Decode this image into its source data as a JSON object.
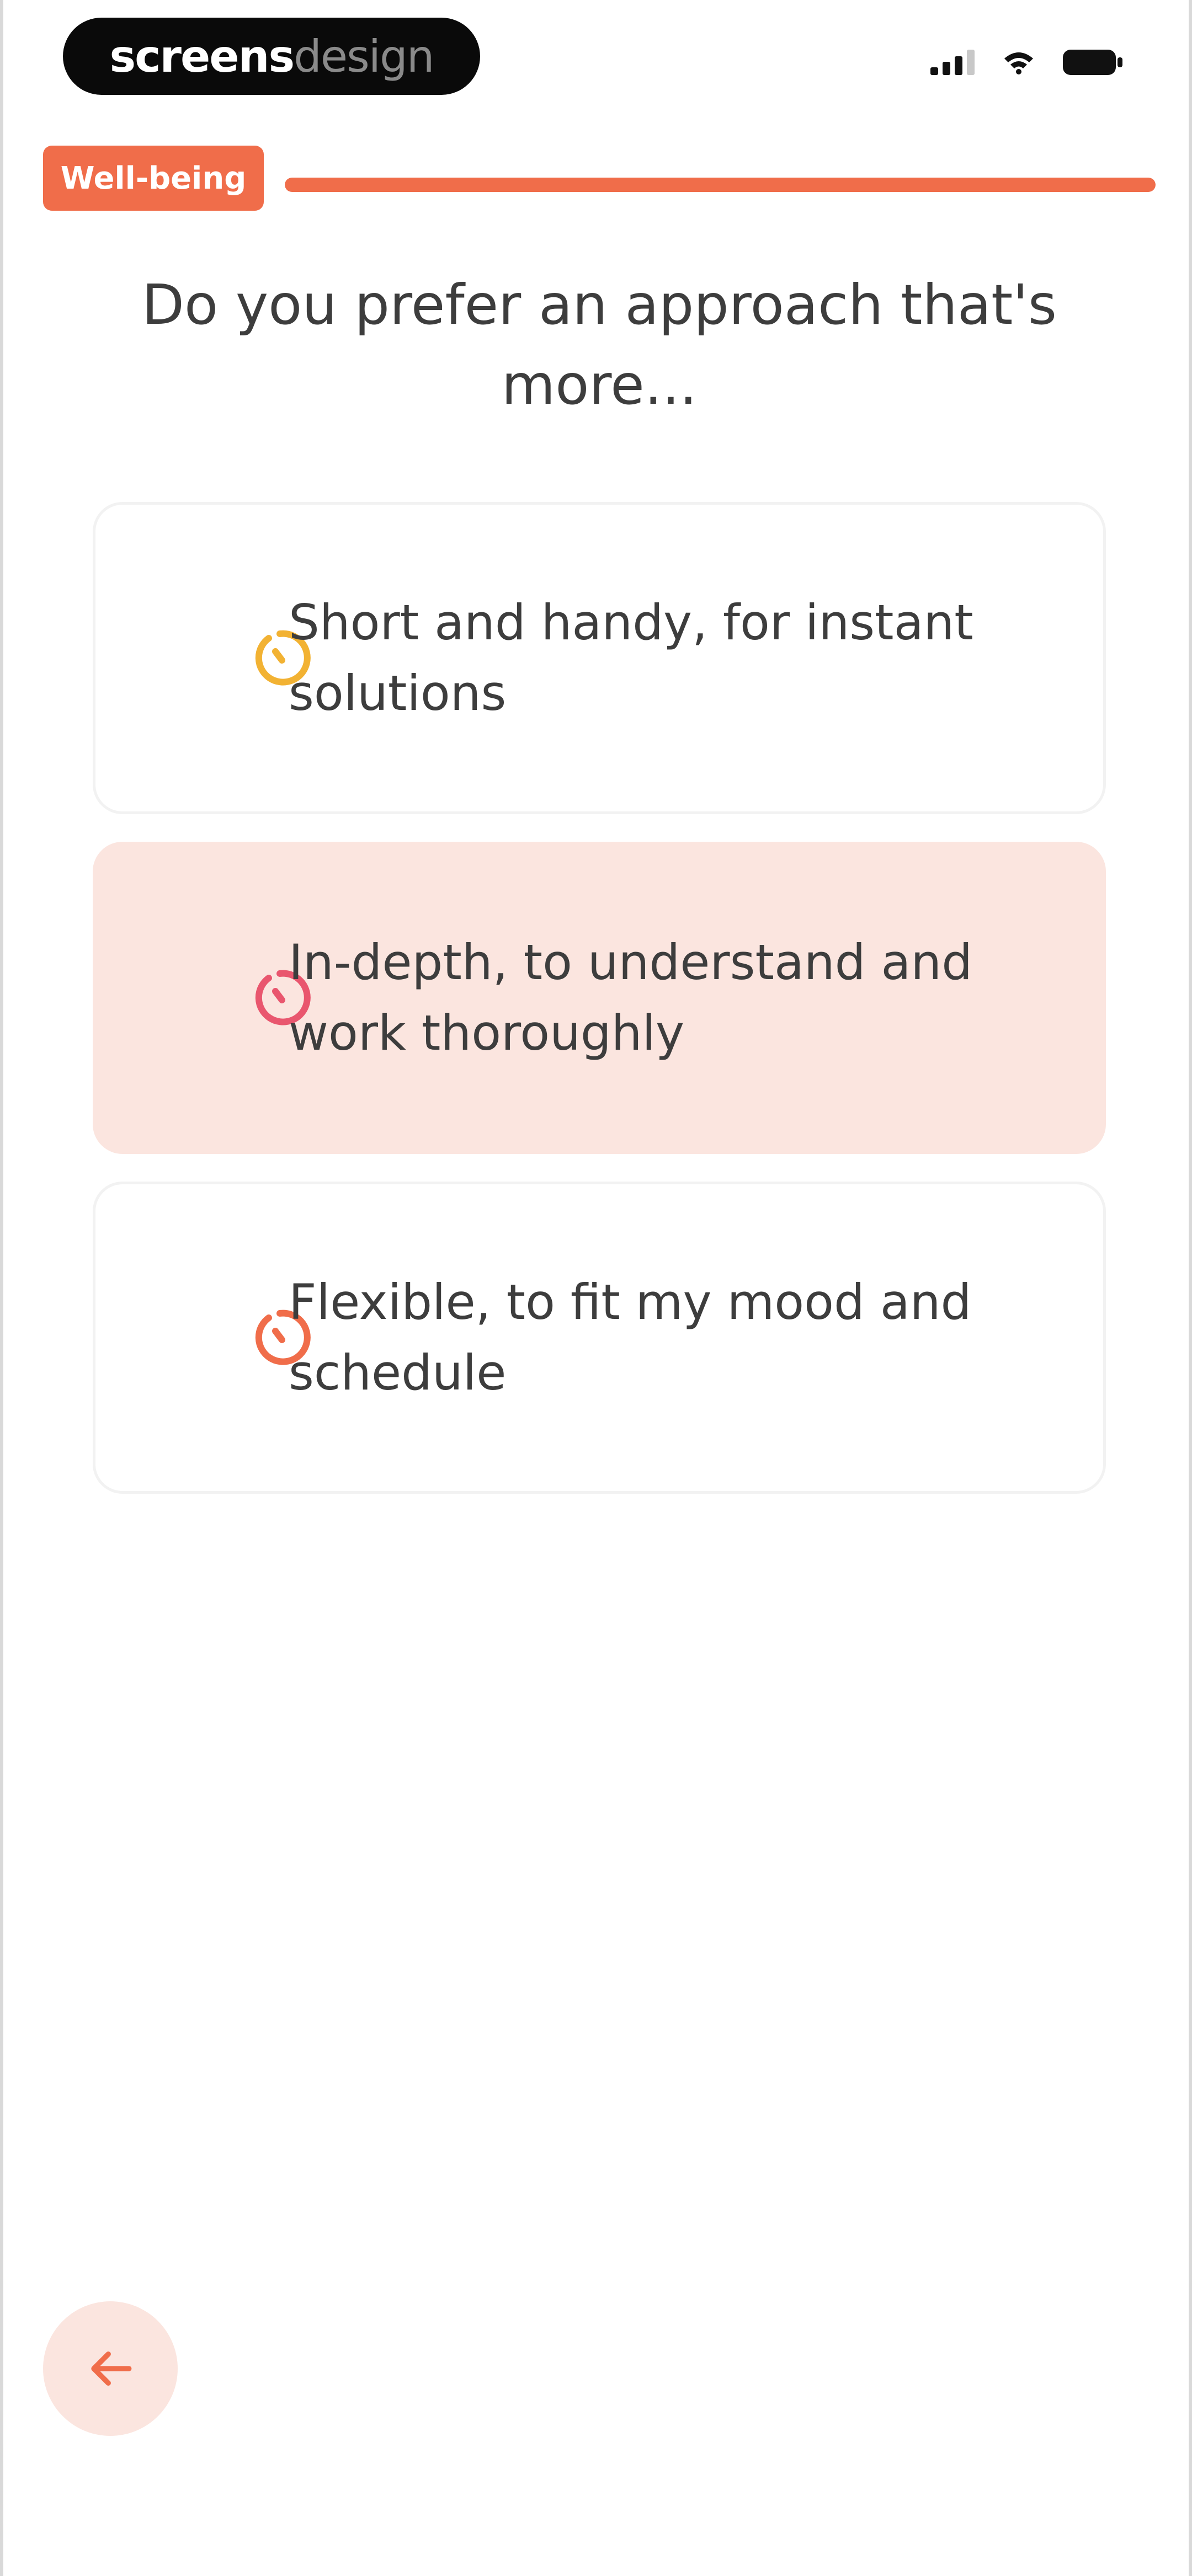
{
  "status_bar": {
    "brand_part1": "screens",
    "brand_part2": "design",
    "icons": [
      "cellular-signal-icon",
      "wifi-icon",
      "battery-icon"
    ]
  },
  "header": {
    "category": "Well-being",
    "progress_fraction": 1.0,
    "accent_color": "#f06d4a"
  },
  "question": {
    "text": "Do you prefer an approach that's more..."
  },
  "options": [
    {
      "label": "Short and handy, for instant solutions",
      "icon": "timer-icon",
      "icon_color": "#f2b233",
      "selected": false
    },
    {
      "label": "In-depth, to understand and work thoroughly",
      "icon": "timer-icon",
      "icon_color": "#e9566e",
      "selected": true
    },
    {
      "label": "Flexible, to fit my mood and schedule",
      "icon": "timer-icon",
      "icon_color": "#f06d4a",
      "selected": false
    }
  ],
  "navigation": {
    "back_icon": "arrow-left-icon"
  }
}
